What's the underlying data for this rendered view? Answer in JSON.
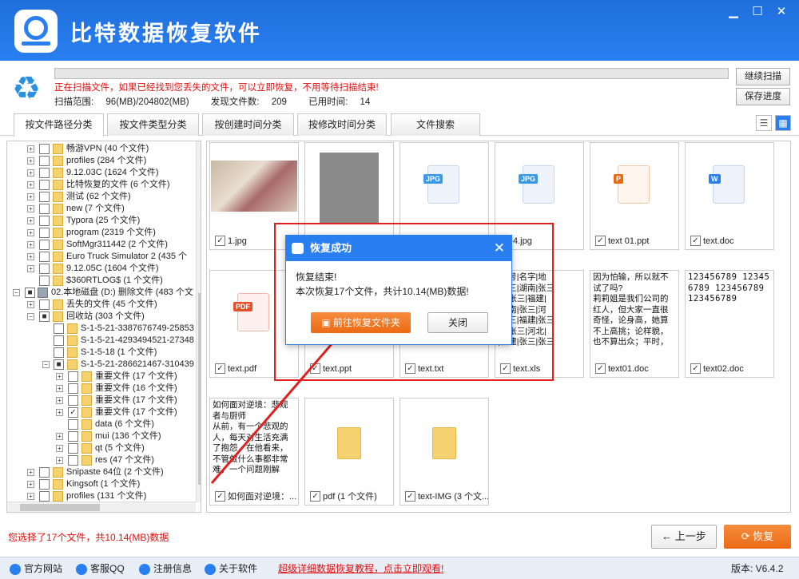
{
  "app": {
    "title": "比特数据恢复软件"
  },
  "window": {
    "min": "▁",
    "max": "☐",
    "close": "✕"
  },
  "scan": {
    "message": "正在扫描文件，如果已经找到您丢失的文件，可以立即恢复，不用等待扫描结束!",
    "range_label": "扫描范围:",
    "range_value": "96(MB)/204802(MB)",
    "found_label": "发现文件数:",
    "found_value": "209",
    "time_label": "已用时间:",
    "time_value": "14",
    "continue_button": "继续扫描",
    "save_button": "保存进度"
  },
  "tabs": [
    "按文件路径分类",
    "按文件类型分类",
    "按创建时间分类",
    "按修改时间分类",
    "文件搜索"
  ],
  "tree": [
    {
      "label": "畅游VPN    (40 个文件)"
    },
    {
      "label": "profiles    (284 个文件)"
    },
    {
      "label": "9.12.03C    (1624 个文件)"
    },
    {
      "label": "比特恢复的文件    (6 个文件)"
    },
    {
      "label": "测试    (62 个文件)"
    },
    {
      "label": "new    (7 个文件)"
    },
    {
      "label": "Typora    (25 个文件)"
    },
    {
      "label": "program    (2319 个文件)"
    },
    {
      "label": "SoftMgr311442    (2 个文件)"
    },
    {
      "label": "Euro Truck Simulator 2    (435 个"
    },
    {
      "label": "9.12.05C    (1604 个文件)"
    },
    {
      "label": "$360RTLOG$    (1 个文件)"
    },
    {
      "label": "02.本地磁盘 (D:) 删除文件 (483 个文"
    },
    {
      "label": "丢失的文件    (45 个文件)"
    },
    {
      "label": "回收站    (303 个文件)"
    },
    {
      "label": "S-1-5-21-3387676749-25853"
    },
    {
      "label": "S-1-5-21-4293494521-27348"
    },
    {
      "label": "S-1-5-18    (1 个文件)"
    },
    {
      "label": "S-1-5-21-286621467-310439"
    },
    {
      "label": "重要文件    (17 个文件)"
    },
    {
      "label": "重要文件    (16 个文件)"
    },
    {
      "label": "重要文件    (17 个文件)"
    },
    {
      "label": "重要文件    (17 个文件)"
    },
    {
      "label": "data    (6 个文件)"
    },
    {
      "label": "mui    (136 个文件)"
    },
    {
      "label": "qt    (5 个文件)"
    },
    {
      "label": "res    (47 个文件)"
    },
    {
      "label": "Snipaste 64位    (2 个文件)"
    },
    {
      "label": "Kingsoft    (1 个文件)"
    },
    {
      "label": "profiles    (131 个文件)"
    }
  ],
  "files": [
    {
      "name": "1.jpg",
      "kind": "photo"
    },
    {
      "name": "",
      "kind": "gray"
    },
    {
      "name": "",
      "kind": "jpg",
      "badge": "JPG"
    },
    {
      "name": "4.jpg",
      "kind": "jpg",
      "badge": "JPG"
    },
    {
      "name": "text 01.ppt",
      "kind": "ppt",
      "badge": "P"
    },
    {
      "name": "text.doc",
      "kind": "doc",
      "badge": "W"
    },
    {
      "name": "text.pdf",
      "kind": "pdf",
      "badge": "PDF"
    },
    {
      "name": "text.ppt",
      "kind": "blank"
    },
    {
      "name": "text.txt",
      "kind": "blank"
    },
    {
      "name": "text.xls",
      "kind": "text",
      "preview": "|序号|名字|地\n|张三|湖南|张三\n北|张三|福建|\n|湖南|张三|河\n|张三|福建|张三\n南|张三|河北|\n|福建|张三|张三\n南|张三|河北|张三"
    },
    {
      "name": "text01.doc",
      "kind": "text",
      "preview": "因为怕输，所以就不试了吗?\n莉莉姐是我们公司的红人，但大家一直很奇怪，论身高，她算不上高挑；论样貌，也不算出众；平时，也不见她跟老板走得"
    },
    {
      "name": "text02.doc",
      "kind": "text",
      "preview": "123456789 123456789 123456789 123456789"
    },
    {
      "name": "如何面对逆境：...",
      "kind": "text",
      "preview": "如何面对逆境：悲观者与厨师\n从前，有一个悲观的人，每天对生活充满了抱怨，在他看来，不管做什么事都非常难，一个问题刚解决，又会出现新的问"
    },
    {
      "name": "pdf (1 个文件)",
      "kind": "folder"
    },
    {
      "name": "text-IMG (3 个文...",
      "kind": "folder"
    }
  ],
  "dialog": {
    "title": "恢复成功",
    "line1": "恢复结束!",
    "line2": "本次恢复17个文件，共计10.14(MB)数据!",
    "open_button": "前往恢复文件夹",
    "close_button": "关闭",
    "close_icon": "✕"
  },
  "status": {
    "selection": "您选择了17个文件，共10.14(MB)数据"
  },
  "nav": {
    "prev_button": "上一步",
    "recover_button": "恢复"
  },
  "footer": {
    "website": "官方网站",
    "support": "客服QQ",
    "register": "注册信息",
    "about": "关于软件",
    "tutorial_link": "超级详细数据恢复教程，点击立即观看!",
    "version": "版本: V6.4.2"
  },
  "colors": {
    "brand": "#2a7ff0",
    "accent": "#ec6a14",
    "warning": "#e01010"
  }
}
